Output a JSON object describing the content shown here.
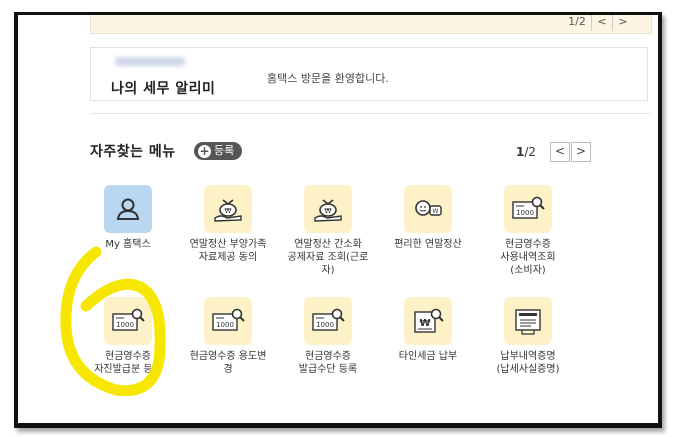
{
  "top_pager": {
    "current": "1/2",
    "prev": "<",
    "next": ">"
  },
  "welcome": {
    "title": "나의 세무 알리미",
    "message": "홈택스 방문을 환영합니다."
  },
  "favorites": {
    "title": "자주찾는 메뉴",
    "register_label": "등록",
    "register_icon": "plus-icon",
    "page_current": "1",
    "page_total": "/2",
    "prev": "<",
    "next": ">",
    "items": [
      {
        "label": "My 홈택스",
        "icon": "user-icon"
      },
      {
        "label": "연말정산 부양가족\n자료제공 동의",
        "icon": "money-bag-icon"
      },
      {
        "label": "연말정산 간소화\n공제자료 조회(근로\n자)",
        "icon": "money-bag-icon"
      },
      {
        "label": "편리한 연말정산",
        "icon": "chat-won-icon"
      },
      {
        "label": "현금영수증\n사용내역조회\n(소비자)",
        "icon": "receipt-search-icon"
      },
      {
        "label": "현금영수증\n자진발급분 등록",
        "icon": "receipt-search-icon"
      },
      {
        "label": "현금영수증 용도변\n경",
        "icon": "receipt-search-icon"
      },
      {
        "label": "현금영수증\n발급수단 등록",
        "icon": "receipt-search-icon"
      },
      {
        "label": "타인세금 납부",
        "icon": "won-search-icon"
      },
      {
        "label": "납부내역증명\n(납세사실증명)",
        "icon": "certificate-icon"
      }
    ]
  },
  "colors": {
    "icon_bg": "#fdf1c8",
    "icon_bg_blue": "#b9d7f1",
    "highlight": "#f7e600"
  }
}
